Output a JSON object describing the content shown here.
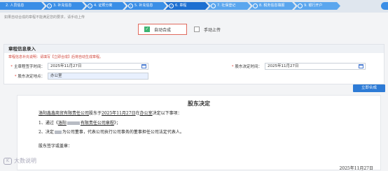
{
  "steps": [
    {
      "label": "2. 人员信息",
      "state": "done"
    },
    {
      "label": "3. 补充信息",
      "state": "done"
    },
    {
      "label": "4. 证照分离",
      "state": "done"
    },
    {
      "label": "5. 补充信息",
      "state": "done"
    },
    {
      "label": "6. 章程",
      "state": "current"
    },
    {
      "label": "7. 社保登记",
      "state": "todo"
    },
    {
      "label": "8. 税务信息填报",
      "state": "todo"
    },
    {
      "label": "9. 银行开户",
      "state": "todo"
    }
  ],
  "notice": "如果自动合成的章程不能满足您的要求，请手动上传",
  "choices": {
    "auto": "自动合成",
    "manual": "手动上传"
  },
  "form": {
    "title": "章程信息录入",
    "warning": "章程信息补充说明：请填写【立即合成】后将自动生成章程。",
    "sign_time_label": "主章程签字时间：",
    "sign_time_value": "2025年11月27日",
    "decision_time_label": "股东决定时间：",
    "decision_time_value": "2025年11月27日",
    "place_label": "股东决定地点：",
    "place_value": "办公室"
  },
  "generate_button": "立即合成",
  "document": {
    "title": "股东决定",
    "company": "洛阳鑫鑫商贸有限责任公司",
    "line1_mid": "股东于",
    "date": "2025年11月27日",
    "line1_in": "在",
    "place": "办公室",
    "line1_end": "决定以下事项：",
    "item1_prefix": "1、通过《",
    "item1_company_suffix": "有限责任公司章程",
    "item1_end": "》；",
    "item2_prefix": "2、决定",
    "item2_mid": "为公司董事，代表公司执行公司事务的董事担任公司法定代表人。",
    "sign": "股东签字或盖章：",
    "end_date": "2025年11月27日"
  },
  "watermark": "大数说明",
  "colors": {
    "step_done": "#3a8ee6",
    "step_current": "#1d6fd1",
    "accent_red": "#e0453a",
    "check_green": "#3cb371"
  }
}
